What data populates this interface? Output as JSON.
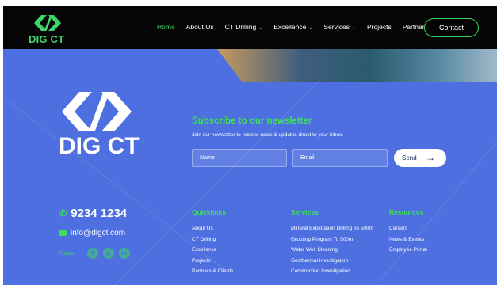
{
  "header": {
    "logo_text": "DIG CT",
    "nav": [
      {
        "label": "Home",
        "active": true,
        "dropdown": false
      },
      {
        "label": "About Us",
        "active": false,
        "dropdown": false
      },
      {
        "label": "CT Drilling",
        "active": false,
        "dropdown": true
      },
      {
        "label": "Excellence",
        "active": false,
        "dropdown": true
      },
      {
        "label": "Services",
        "active": false,
        "dropdown": true
      },
      {
        "label": "Projects",
        "active": false,
        "dropdown": false
      },
      {
        "label": "Partners",
        "active": false,
        "dropdown": false
      }
    ],
    "contact_label": "Contact"
  },
  "footer": {
    "logo_text": "DIG CT",
    "newsletter": {
      "title": "Subscribe to our newsletter",
      "subtitle": "Join our newsletter to recieve news & updates direct to your inbox.",
      "name_placeholder": "Name",
      "email_placeholder": "Email",
      "send_label": "Send"
    },
    "phone": "9234 1234",
    "email": "info@digct.com",
    "follow_label": "Follow:",
    "socials": [
      {
        "icon": "facebook-icon",
        "glyph": "f"
      },
      {
        "icon": "instagram-icon",
        "glyph": "◎"
      },
      {
        "icon": "linkedin-icon",
        "glyph": "in"
      }
    ],
    "quicklinks": {
      "title": "Quicklinks",
      "items": [
        "About Us",
        "CT Drilling",
        "Excellence",
        "Projects",
        "Partners & Clients"
      ]
    },
    "services": {
      "title": "Services",
      "items": [
        "Mineral Exploration Drilling To 500m",
        "Grouting Program To 500m",
        "Water Well Cleaning",
        "Geothermal Investigation",
        "Construction Investigation"
      ]
    },
    "resources": {
      "title": "Resources",
      "items": [
        "Careers",
        "News & Events",
        "Employee Portal"
      ]
    }
  },
  "colors": {
    "accent": "#36d35e",
    "footer_bg": "#4d6fe0",
    "header_bg": "#050505"
  }
}
